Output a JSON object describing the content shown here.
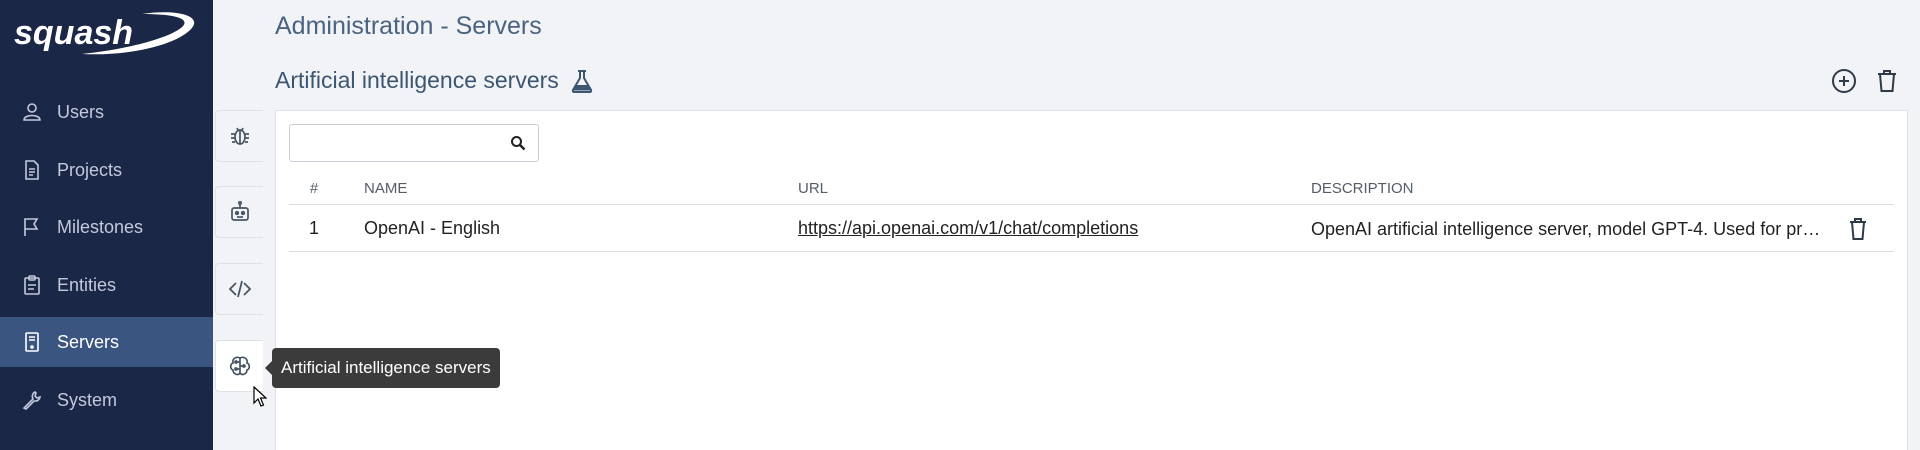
{
  "app": {
    "logo_text": "squash"
  },
  "sidebar": {
    "items": [
      {
        "label": "Users",
        "icon": "user-icon"
      },
      {
        "label": "Projects",
        "icon": "document-icon"
      },
      {
        "label": "Milestones",
        "icon": "flag-icon"
      },
      {
        "label": "Entities",
        "icon": "clipboard-icon"
      },
      {
        "label": "Servers",
        "icon": "server-icon",
        "active": true
      },
      {
        "label": "System",
        "icon": "wrench-icon"
      }
    ]
  },
  "header": {
    "page_title": "Administration - Servers",
    "section_title": "Artificial intelligence servers"
  },
  "subnav": {
    "items": [
      {
        "icon": "bug-icon"
      },
      {
        "icon": "robot-icon"
      },
      {
        "icon": "code-icon"
      },
      {
        "icon": "brain-icon",
        "active": true
      }
    ]
  },
  "search": {
    "value": "",
    "placeholder": ""
  },
  "table": {
    "columns": [
      "#",
      "NAME",
      "URL",
      "DESCRIPTION"
    ],
    "rows": [
      {
        "num": "1",
        "name": "OpenAI - English",
        "url": "https://api.openai.com/v1/chat/completions",
        "description": "OpenAI artificial intelligence server, model GPT-4. Used for proje..."
      }
    ]
  },
  "tooltip": {
    "text": "Artificial intelligence servers"
  },
  "colors": {
    "sidebar_bg": "#1b2747",
    "sidebar_active": "#3a5580",
    "title": "#4a6380",
    "tooltip_bg": "#3b3b3b"
  }
}
